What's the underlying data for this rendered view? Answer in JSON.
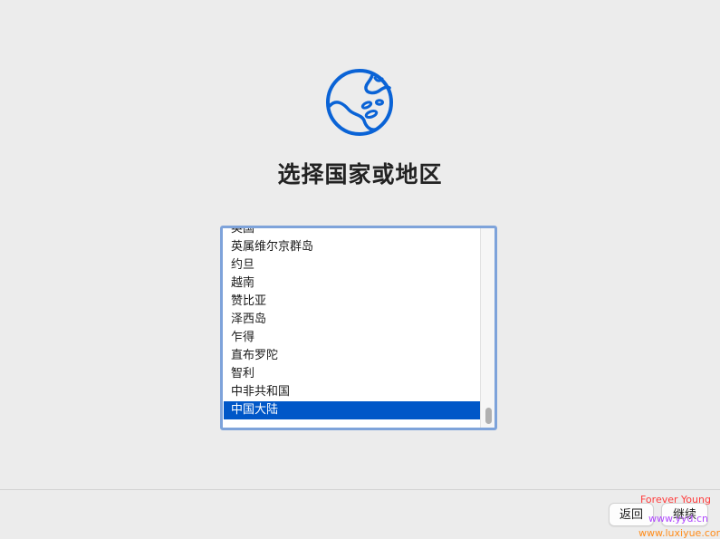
{
  "page": {
    "title": "选择国家或地区",
    "icon": "globe-icon"
  },
  "country_list": {
    "items": [
      "英国",
      "英属维尔京群岛",
      "约旦",
      "越南",
      "赞比亚",
      "泽西岛",
      "乍得",
      "直布罗陀",
      "智利",
      "中非共和国",
      "中国大陆"
    ],
    "selected": "中国大陆"
  },
  "footer": {
    "back_label": "返回",
    "continue_label": "继续"
  },
  "watermark": {
    "line1": "Forever Young",
    "line2": "www.yyd.cn",
    "line3": "www.luxiyue.com"
  },
  "colors": {
    "accent": "#0a63d6",
    "selection": "#0057c8",
    "focus_ring": "#7ea3da",
    "background": "#ececec"
  }
}
